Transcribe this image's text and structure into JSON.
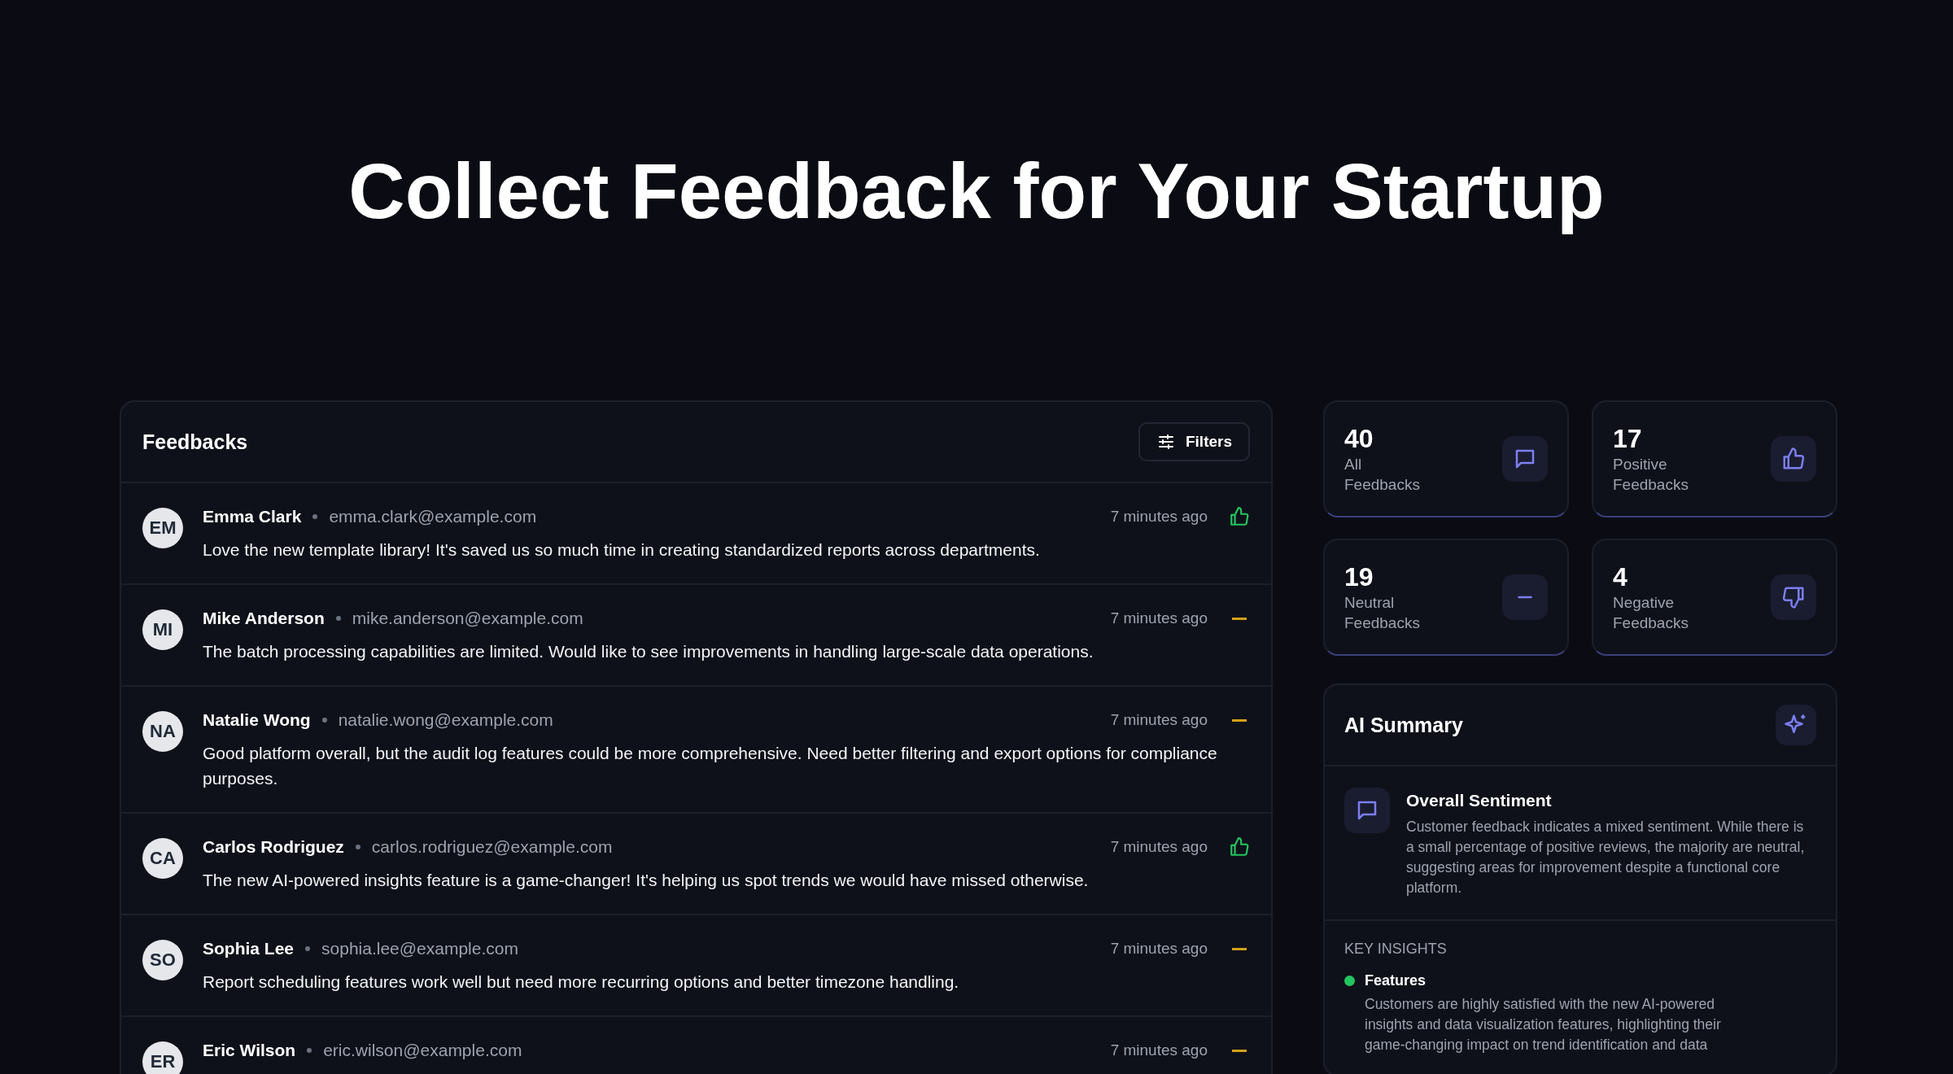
{
  "hero": {
    "title": "Collect Feedback for Your Startup"
  },
  "feedbacks": {
    "title": "Feedbacks",
    "filter_button": "Filters",
    "items": [
      {
        "initials": "EM",
        "name": "Emma Clark",
        "email": "emma.clark@example.com",
        "time": "7 minutes ago",
        "kind": "positive",
        "message": "Love the new template library! It's saved us so much time in creating standardized reports across departments."
      },
      {
        "initials": "MI",
        "name": "Mike Anderson",
        "email": "mike.anderson@example.com",
        "time": "7 minutes ago",
        "kind": "neutral",
        "message": "The batch processing capabilities are limited. Would like to see improvements in handling large-scale data operations."
      },
      {
        "initials": "NA",
        "name": "Natalie Wong",
        "email": "natalie.wong@example.com",
        "time": "7 minutes ago",
        "kind": "neutral",
        "message": "Good platform overall, but the audit log features could be more comprehensive. Need better filtering and export options for compliance purposes."
      },
      {
        "initials": "CA",
        "name": "Carlos Rodriguez",
        "email": "carlos.rodriguez@example.com",
        "time": "7 minutes ago",
        "kind": "positive",
        "message": "The new AI-powered insights feature is a game-changer! It's helping us spot trends we would have missed otherwise."
      },
      {
        "initials": "SO",
        "name": "Sophia Lee",
        "email": "sophia.lee@example.com",
        "time": "7 minutes ago",
        "kind": "neutral",
        "message": "Report scheduling features work well but need more recurring options and better timezone handling."
      },
      {
        "initials": "ER",
        "name": "Eric Wilson",
        "email": "eric.wilson@example.com",
        "time": "7 minutes ago",
        "kind": "neutral"
      }
    ]
  },
  "stats": [
    {
      "kind": "all",
      "value": "40",
      "label_1": "All",
      "label_2": "Feedbacks"
    },
    {
      "kind": "positive",
      "value": "17",
      "label_1": "Positive",
      "label_2": "Feedbacks"
    },
    {
      "kind": "neutral",
      "value": "19",
      "label_1": "Neutral",
      "label_2": "Feedbacks"
    },
    {
      "kind": "negative",
      "value": "4",
      "label_1": "Negative",
      "label_2": "Feedbacks"
    }
  ],
  "ai_summary": {
    "title": "AI Summary",
    "sentiment": {
      "title": "Overall Sentiment",
      "text": "Customer feedback indicates a mixed sentiment. While there is a small percentage of positive reviews, the majority are neutral, suggesting areas for improvement despite a functional core platform."
    },
    "insights_heading": "KEY INSIGHTS",
    "insights": [
      {
        "title": "Features",
        "color": "#22c55e",
        "lines": [
          "Customers are highly satisfied with the new AI-powered",
          "insights and data visualization features, highlighting their",
          "game-changing impact on trend identification and data"
        ]
      }
    ]
  }
}
